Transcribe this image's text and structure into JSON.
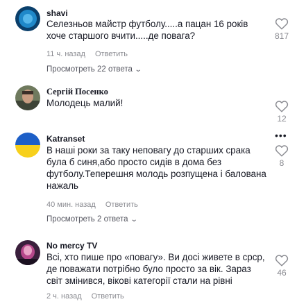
{
  "comments": [
    {
      "author": "shavi",
      "text": "Селезньов майстр футболу.....а пацан 16 років хоче старшого вчити.....де повага?",
      "time": "11 ч. назад",
      "reply_label": "Ответить",
      "likes": "817",
      "view_replies": "Просмотреть 22 ответа",
      "avatar_colors": {
        "ring": "#0a3f6b",
        "inner": "#1f88c9"
      }
    },
    {
      "author": "Сергій Посенко",
      "text": "Молодець малий!",
      "likes": "12",
      "avatar_colors": {
        "bg": "#6f7a5e",
        "face": "#c99d82"
      }
    },
    {
      "author": "Katranset",
      "text": "В наші роки за таку неповагу до старших срака була б синя,або просто сидів в дома без футболу.Теперешня молодь розпущена і балована нажаль",
      "time": "40 мин. назад",
      "reply_label": "Ответить",
      "likes": "8",
      "view_replies": "Просмотреть 2 ответа",
      "avatar_colors": {
        "top": "#1d5fc7",
        "bottom": "#f7d01c"
      }
    },
    {
      "author": "No mercy TV",
      "text": "Всі, хто пише про «повагу». Ви досі живете в срср, де поважати потрібно було просто за вік. Зараз світ змінився, вікові категорії стали на рівні",
      "time": "2 ч. назад",
      "reply_label": "Ответить",
      "likes": "46",
      "avatar_colors": {
        "bg": "#3a1f3c",
        "face": "#b5478a"
      }
    }
  ],
  "icons": {
    "like": "heart-outline-icon",
    "more": "more-options-icon",
    "expand": "chevron-down-icon"
  }
}
